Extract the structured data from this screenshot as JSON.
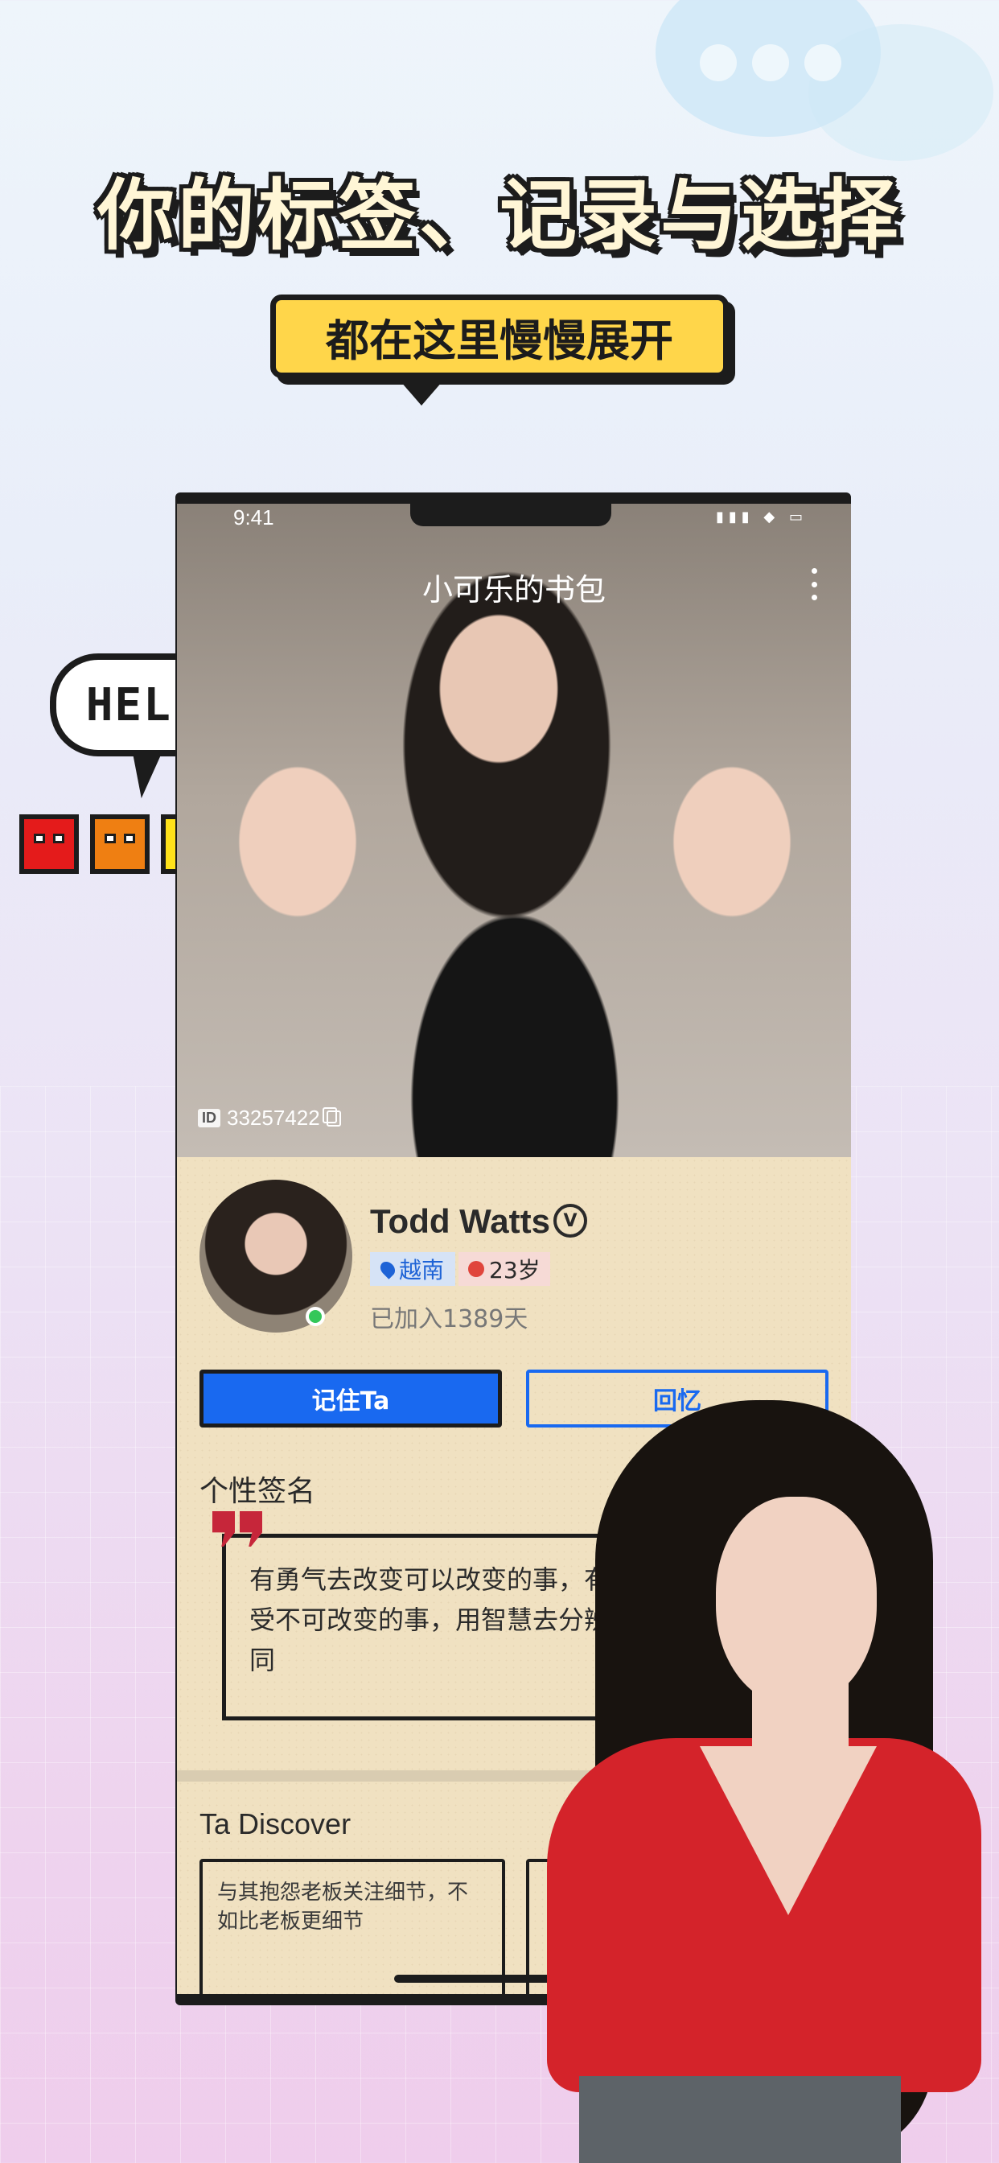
{
  "headline": "你的标签、记录与选择",
  "subtitle": "都在这里慢慢展开",
  "hello_text": "HELLO",
  "block_colors": [
    "#e41b1b",
    "#ef7f12",
    "#ffe21a",
    "#28c43a"
  ],
  "phone": {
    "status": {
      "time": "9:41"
    },
    "photo": {
      "title": "小可乐的书包",
      "id_label": "ID",
      "id_value": "33257422"
    },
    "profile": {
      "name": "Todd Watts",
      "location": "越南",
      "age": "23岁",
      "joined": "已加入1389天",
      "primary_button": "记住Ta",
      "secondary_button": "回忆",
      "signature_title": "个性签名",
      "signature_text": "有勇气去改变可以改变的事，有胸怀去接受不可改变的事，用智慧去分辨两者的不同",
      "discover_title": "Ta Discover",
      "discover_card_text": "与其抱怨老板关注细节，不如比老板更细节"
    }
  },
  "colors": {
    "accent_blue": "#1969f0",
    "subtitle_yellow": "#ffd64a",
    "card_beige": "#f0e1c1"
  }
}
